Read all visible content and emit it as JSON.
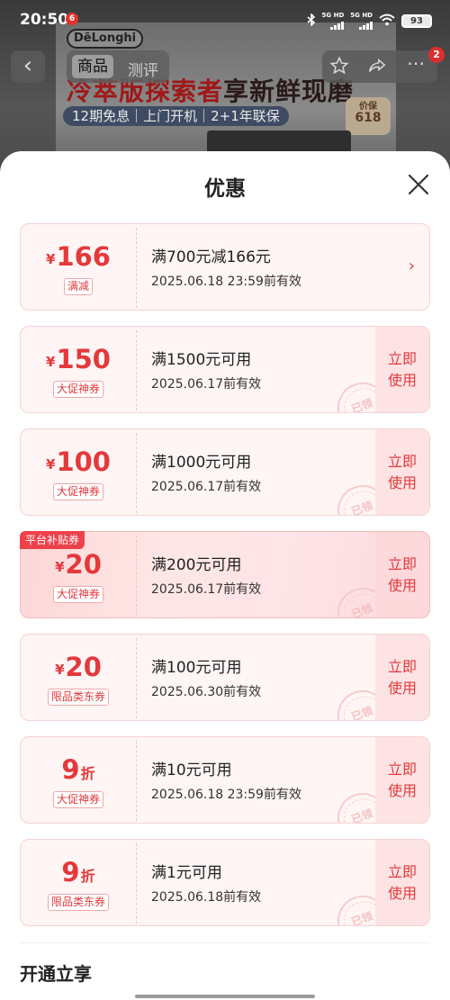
{
  "status_bar": {
    "time": "20:50",
    "app_badge": "6",
    "net1": "5G HD",
    "net2": "5G HD",
    "battery": "93"
  },
  "background_page": {
    "brand": "DēLonghi",
    "headline_red": "冷萃版探索者",
    "headline_dark": "享新鲜现磨",
    "subline": "12期免息｜上门开机｜2+1年联保",
    "badge_line1": "价保",
    "badge_line2": "618",
    "nav_back_icon": "chevron-left-icon",
    "tabs": [
      "商品",
      "测评"
    ],
    "icons": [
      "star-icon",
      "share-icon",
      "more-icon"
    ],
    "more_badge": "2"
  },
  "sheet": {
    "title": "优惠",
    "close_icon": "close-icon",
    "accent_color": "#e4393c"
  },
  "coupons": [
    {
      "currency": "¥",
      "amount": "166",
      "suffix": "",
      "tag": "满减",
      "condition": "满700元减166元",
      "expiry": "2025.06.18 23:59前有效",
      "action": "arrow",
      "arrow": "›",
      "highlight": false,
      "ribbon": ""
    },
    {
      "currency": "¥",
      "amount": "150",
      "suffix": "",
      "tag": "大促神券",
      "condition": "满1500元可用",
      "expiry": "2025.06.17前有效",
      "action_line1": "立即",
      "action_line2": "使用",
      "stamp": "已领",
      "highlight": false,
      "ribbon": ""
    },
    {
      "currency": "¥",
      "amount": "100",
      "suffix": "",
      "tag": "大促神券",
      "condition": "满1000元可用",
      "expiry": "2025.06.17前有效",
      "action_line1": "立即",
      "action_line2": "使用",
      "stamp": "已领",
      "highlight": false,
      "ribbon": ""
    },
    {
      "currency": "¥",
      "amount": "20",
      "suffix": "",
      "tag": "大促神券",
      "condition": "满200元可用",
      "expiry": "2025.06.17前有效",
      "action_line1": "立即",
      "action_line2": "使用",
      "stamp": "已领",
      "highlight": true,
      "ribbon": "平台补贴券"
    },
    {
      "currency": "¥",
      "amount": "20",
      "suffix": "",
      "tag": "限品类东券",
      "condition": "满100元可用",
      "expiry": "2025.06.30前有效",
      "action_line1": "立即",
      "action_line2": "使用",
      "stamp": "已领",
      "highlight": false,
      "ribbon": ""
    },
    {
      "currency": "",
      "amount": "9",
      "suffix": "折",
      "tag": "大促神券",
      "condition": "满10元可用",
      "expiry": "2025.06.18 23:59前有效",
      "action_line1": "立即",
      "action_line2": "使用",
      "stamp": "已领",
      "highlight": false,
      "ribbon": ""
    },
    {
      "currency": "",
      "amount": "9",
      "suffix": "折",
      "tag": "限品类东券",
      "condition": "满1元可用",
      "expiry": "2025.06.18前有效",
      "action_line1": "立即",
      "action_line2": "使用",
      "stamp": "已领",
      "highlight": false,
      "ribbon": ""
    }
  ],
  "bottom_section": {
    "heading": "开通立享"
  }
}
